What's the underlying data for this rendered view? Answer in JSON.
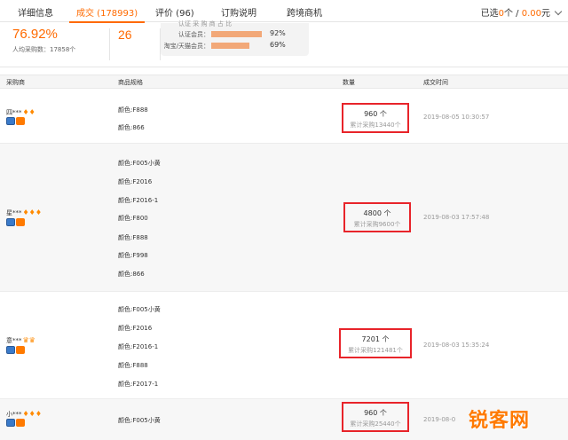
{
  "tabs": [
    {
      "label": "详细信息"
    },
    {
      "label": "成交 (178993)"
    },
    {
      "label": "评价 (96)"
    },
    {
      "label": "订购说明"
    },
    {
      "label": "跨境商机"
    }
  ],
  "selected": {
    "prefix": "已选",
    "count": "0",
    "unit": "个",
    "sep": "/",
    "amount": "0.00",
    "currency": "元"
  },
  "stats": {
    "repeat_rate": "76.92%",
    "avg_qty_text": "人均采购数：17858个",
    "count": "26",
    "clipped_label": "认证 采 购 商 占 比",
    "members": [
      {
        "label": "认证会员：",
        "percent": "92%",
        "fill": 0.92
      },
      {
        "label": "淘宝/天猫会员：",
        "percent": "69%",
        "fill": 0.69
      }
    ]
  },
  "table": {
    "headers": {
      "buyer": "采购商",
      "spec": "商品规格",
      "qty": "数量",
      "time": "成交时间"
    },
    "rows": [
      {
        "buyer": "四***",
        "gems": "♦♦",
        "specs": [
          "颜色:F888",
          "颜色:866"
        ],
        "qty": "960 个",
        "cumulative": "累计采购13440个",
        "time": "2019-08-05 10:30:57"
      },
      {
        "buyer": "星***",
        "gems": "♦♦♦",
        "specs": [
          "颜色:F005小黄",
          "颜色:F2016",
          "颜色:F2016-1",
          "颜色:F800",
          "颜色:F888",
          "颜色:F998",
          "颜色:866"
        ],
        "qty": "4800 个",
        "cumulative": "累计采购9600个",
        "time": "2019-08-03 17:57:48"
      },
      {
        "buyer": "意***",
        "gems": "♛♛",
        "specs": [
          "颜色:F005小黄",
          "颜色:F2016",
          "颜色:F2016-1",
          "颜色:F888",
          "颜色:F2017-1"
        ],
        "qty": "7201 个",
        "cumulative": "累计采购121481个",
        "time": "2019-08-03 15:35:24"
      },
      {
        "buyer": "小***",
        "gems": "♦♦♦",
        "specs": [
          "颜色:F005小黄"
        ],
        "qty": "960 个",
        "cumulative": "累计采购25440个",
        "time": "2019-08-0"
      }
    ]
  },
  "watermark": {
    "text": "锐客网",
    "badge": "头"
  },
  "colors": {
    "accent": "#ff6a00",
    "highlight_box": "#e8242a",
    "bar": "#f2a878"
  }
}
